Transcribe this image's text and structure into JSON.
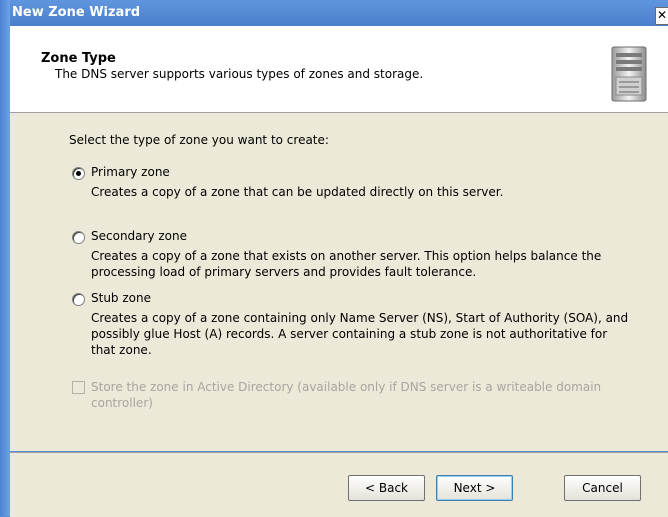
{
  "window": {
    "title": "New Zone Wizard",
    "close_glyph": "✕"
  },
  "header": {
    "title": "Zone Type",
    "subtitle": "The DNS server supports various types of zones and storage."
  },
  "main": {
    "prompt": "Select the type of zone you want to create:",
    "options": [
      {
        "label": "Primary zone",
        "selected": true,
        "description": "Creates a copy of a zone that can be updated directly on this server."
      },
      {
        "label": "Secondary zone",
        "selected": false,
        "description": "Creates a copy of a zone that exists on another server. This option helps balance the processing load of primary servers and provides fault tolerance."
      },
      {
        "label": "Stub zone",
        "selected": false,
        "description": "Creates a copy of a zone containing only Name Server (NS), Start of Authority (SOA), and possibly glue Host (A) records. A server containing a stub zone is not authoritative for that zone."
      }
    ],
    "store_in_ad": {
      "label": "Store the zone in Active Directory (available only if DNS server is a writeable domain controller)",
      "checked": false,
      "enabled": false
    }
  },
  "buttons": {
    "back": "< Back",
    "next": "Next >",
    "cancel": "Cancel"
  },
  "icons": {
    "header": "server-icon"
  }
}
